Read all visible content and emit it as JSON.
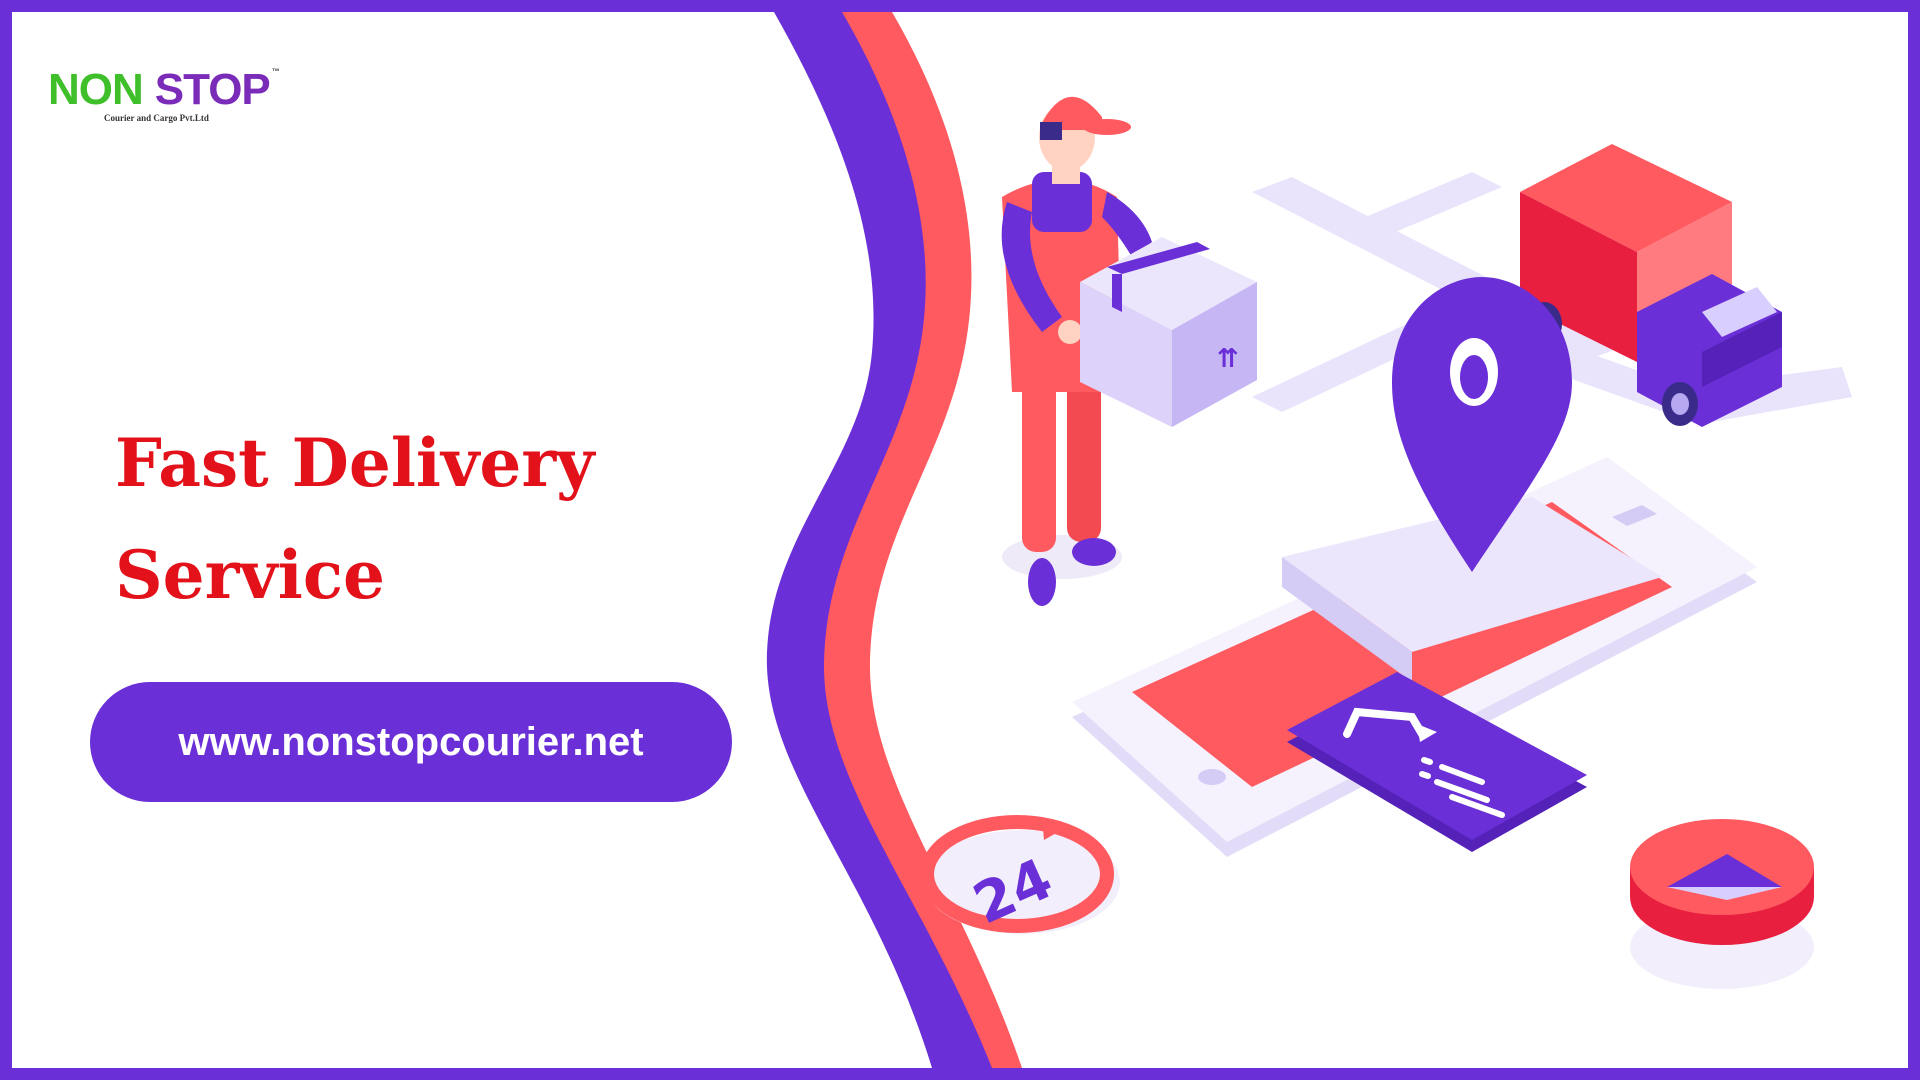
{
  "brand": {
    "name_part1": "NON",
    "name_part2": "STOP",
    "trademark": "™",
    "tagline": "Courier and Cargo Pvt.Ltd"
  },
  "headline": {
    "line1": "Fast Delivery",
    "line2": "Service"
  },
  "website": {
    "url": "www.nonstopcourier.net"
  },
  "badge_24": {
    "text": "24"
  },
  "colors": {
    "primary_purple": "#6a2fd6",
    "accent_red": "#ff5a5f",
    "headline_red": "#e3111a",
    "light_lavender": "#e9e4fb",
    "brand_green": "#3fbf2a"
  },
  "icons": [
    "delivery-person-icon",
    "parcel-box-icon",
    "delivery-truck-icon",
    "location-pin-icon",
    "smartphone-icon",
    "turn-right-card-icon",
    "24-hour-icon",
    "map-marker-button-icon"
  ]
}
